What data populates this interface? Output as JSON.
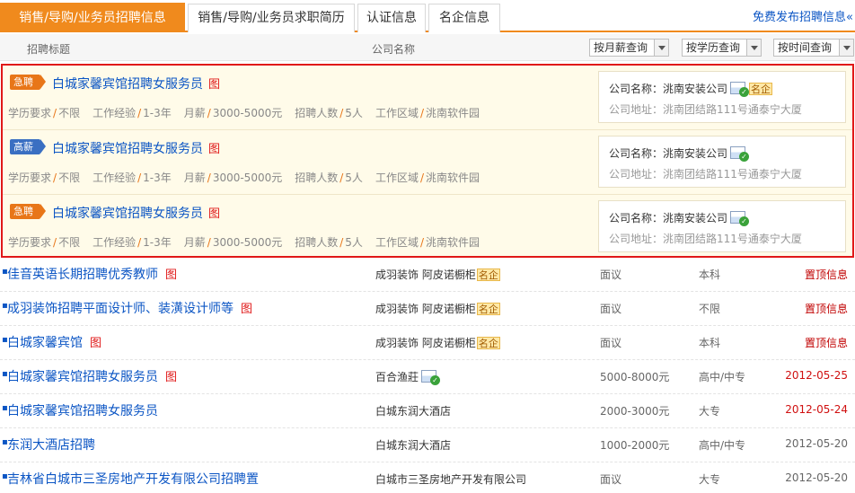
{
  "tabs": [
    {
      "label": "销售/导购/业务员招聘信息",
      "active": true
    },
    {
      "label": "销售/导购/业务员求职简历",
      "active": false
    },
    {
      "label": "认证信息",
      "active": false
    },
    {
      "label": "名企信息",
      "active": false
    }
  ],
  "publish_link": "免费发布招聘信息«",
  "columns": {
    "title": "招聘标题",
    "company": "公司名称",
    "sort_salary": "按月薪查询",
    "sort_edu": "按学历查询",
    "sort_time": "按时间查询"
  },
  "labels": {
    "edu": "学历要求",
    "exp": "工作经验",
    "salary": "月薪",
    "count": "招聘人数",
    "area": "工作区域",
    "company_name": "公司名称：",
    "company_addr": "公司地址：",
    "pic": "图",
    "famous": "名企"
  },
  "featured": [
    {
      "badge": "急聘",
      "badge_type": "urgent",
      "title": "白城家馨宾馆招聘女服务员",
      "edu": "不限",
      "exp": "1-3年",
      "salary": "3000-5000元",
      "count": "5人",
      "area": "洮南软件园",
      "company": "洮南安装公司",
      "address": "洮南团结路111号通泰宁大厦",
      "famous": true
    },
    {
      "badge": "高薪",
      "badge_type": "high",
      "title": "白城家馨宾馆招聘女服务员",
      "edu": "不限",
      "exp": "1-3年",
      "salary": "3000-5000元",
      "count": "5人",
      "area": "洮南软件园",
      "company": "洮南安装公司",
      "address": "洮南团结路111号通泰宁大厦",
      "famous": false
    },
    {
      "badge": "急聘",
      "badge_type": "urgent",
      "title": "白城家馨宾馆招聘女服务员",
      "edu": "不限",
      "exp": "1-3年",
      "salary": "3000-5000元",
      "count": "5人",
      "area": "洮南软件园",
      "company": "洮南安装公司",
      "address": "洮南团结路111号通泰宁大厦",
      "famous": false
    }
  ],
  "listings": [
    {
      "title": "佳音英语长期招聘优秀教师",
      "pic": true,
      "company": "成羽装饰 阿皮诺橱柜",
      "famous": true,
      "cert": false,
      "salary": "面议",
      "edu": "本科",
      "date": "置顶信息",
      "date_style": "top"
    },
    {
      "title": "成羽装饰招聘平面设计师、装潢设计师等",
      "pic": true,
      "company": "成羽装饰 阿皮诺橱柜",
      "famous": true,
      "cert": false,
      "salary": "面议",
      "edu": "不限",
      "date": "置顶信息",
      "date_style": "top"
    },
    {
      "title": "白城家馨宾馆",
      "pic": true,
      "company": "成羽装饰 阿皮诺橱柜",
      "famous": true,
      "cert": false,
      "salary": "面议",
      "edu": "本科",
      "date": "置顶信息",
      "date_style": "top"
    },
    {
      "title": "白城家馨宾馆招聘女服务员",
      "pic": true,
      "company": "百合渔莊",
      "famous": false,
      "cert": true,
      "salary": "5000-8000元",
      "edu": "高中/中专",
      "date": "2012-05-25",
      "date_style": "red"
    },
    {
      "title": "白城家馨宾馆招聘女服务员",
      "pic": false,
      "company": "白城东润大酒店",
      "famous": false,
      "cert": false,
      "salary": "2000-3000元",
      "edu": "大专",
      "date": "2012-05-24",
      "date_style": "red"
    },
    {
      "title": "东润大酒店招聘",
      "pic": false,
      "company": "白城东润大酒店",
      "famous": false,
      "cert": false,
      "salary": "1000-2000元",
      "edu": "高中/中专",
      "date": "2012-05-20",
      "date_style": "normal"
    },
    {
      "title": "吉林省白城市三圣房地产开发有限公司招聘置",
      "pic": false,
      "company": "白城市三圣房地产开发有限公司",
      "famous": false,
      "cert": false,
      "salary": "面议",
      "edu": "大专",
      "date": "2012-05-20",
      "date_style": "normal"
    }
  ],
  "colors": {
    "accent": "#f08a1d",
    "link": "#0b55c4",
    "featured_border": "#e01818",
    "featured_bg": "#fffbe9"
  }
}
